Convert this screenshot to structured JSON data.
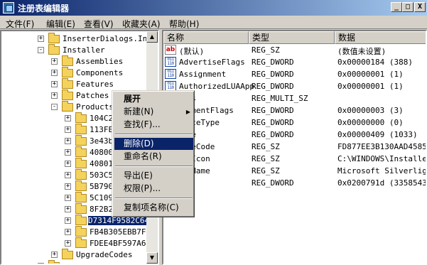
{
  "window": {
    "title": "注册表编辑器",
    "min": "_",
    "max": "□",
    "close": "X"
  },
  "menu": [
    "文件(F)",
    "编辑(E)",
    "查看(V)",
    "收藏夹(A)",
    "帮助(H)"
  ],
  "tree": {
    "items": [
      {
        "label": "InserterDialogs.Ins",
        "expander": "+"
      },
      {
        "label": "Installer",
        "expander": "-"
      },
      {
        "label": "Assemblies",
        "expander": "+"
      },
      {
        "label": "Components",
        "expander": "+"
      },
      {
        "label": "Features",
        "expander": "+"
      },
      {
        "label": "Patches",
        "expander": "+"
      },
      {
        "label": "Products",
        "expander": "-"
      },
      {
        "label": "104C2",
        "expander": "+"
      },
      {
        "label": "113FE",
        "expander": "+"
      },
      {
        "label": "3e43b",
        "expander": "+"
      },
      {
        "label": "40800",
        "expander": "+"
      },
      {
        "label": "40801",
        "expander": "+"
      },
      {
        "label": "503C5",
        "expander": "+"
      },
      {
        "label": "5B790",
        "expander": "+"
      },
      {
        "label": "5C109",
        "expander": "+"
      },
      {
        "label": "8F2B2",
        "expander": "+"
      },
      {
        "label": "D7314F9582C64",
        "expander": "+"
      },
      {
        "label": "FB4B305EBB7FF",
        "expander": "+"
      },
      {
        "label": "FDEE4BF597A63",
        "expander": "+"
      },
      {
        "label": "UpgradeCodes",
        "expander": "+"
      },
      {
        "label": "",
        "expander": "+"
      }
    ]
  },
  "columns": {
    "name": "名称",
    "type": "类型",
    "data": "数据"
  },
  "values": [
    {
      "icon": "ab",
      "name": "(默认)",
      "type": "REG_SZ",
      "data": "(数值未设置)"
    },
    {
      "icon": "bin",
      "name": "AdvertiseFlags",
      "type": "REG_DWORD",
      "data": "0x00000184 (388)"
    },
    {
      "icon": "bin",
      "name": "Assignment",
      "type": "REG_DWORD",
      "data": "0x00000001 (1)"
    },
    {
      "icon": "bin",
      "name": "AuthorizedLUAApp",
      "type": "REG_DWORD",
      "data": "0x00000001 (1)"
    },
    {
      "icon": "none",
      "name": "nts",
      "type": "REG_MULTI_SZ",
      "data": ""
    },
    {
      "icon": "none",
      "name": "oymentFlags",
      "type": "REG_DWORD",
      "data": "0x00000003 (3)"
    },
    {
      "icon": "none",
      "name": "anceType",
      "type": "REG_DWORD",
      "data": "0x00000000 (0)"
    },
    {
      "icon": "none",
      "name": "age",
      "type": "REG_DWORD",
      "data": "0x00000409 (1033)"
    },
    {
      "icon": "none",
      "name": "ageCode",
      "type": "REG_SZ",
      "data": "FD877EE3B130AAD45853"
    },
    {
      "icon": "none",
      "name": "ctIcon",
      "type": "REG_SZ",
      "data": "C:\\WINDOWS\\Installer\\"
    },
    {
      "icon": "none",
      "name": "ctName",
      "type": "REG_SZ",
      "data": "Microsoft Silverlight"
    },
    {
      "icon": "none",
      "name": "on",
      "type": "REG_DWORD",
      "data": "0x0200791d (33585437)"
    }
  ],
  "context_menu": {
    "expand": "展开",
    "new": "新建(N)",
    "new_arrow": "▶",
    "find": "查找(F)...",
    "delete": "删除(D)",
    "rename": "重命名(R)",
    "export": "导出(E)",
    "permissions": "权限(P)...",
    "copy_key_name": "复制项名称(C)"
  },
  "scroll": {
    "up": "▲",
    "down": "▼"
  },
  "colors": {
    "title_start": "#0a246a",
    "title_end": "#a6caf0",
    "highlight": "#0a246a",
    "folder": "#f4d25c"
  }
}
